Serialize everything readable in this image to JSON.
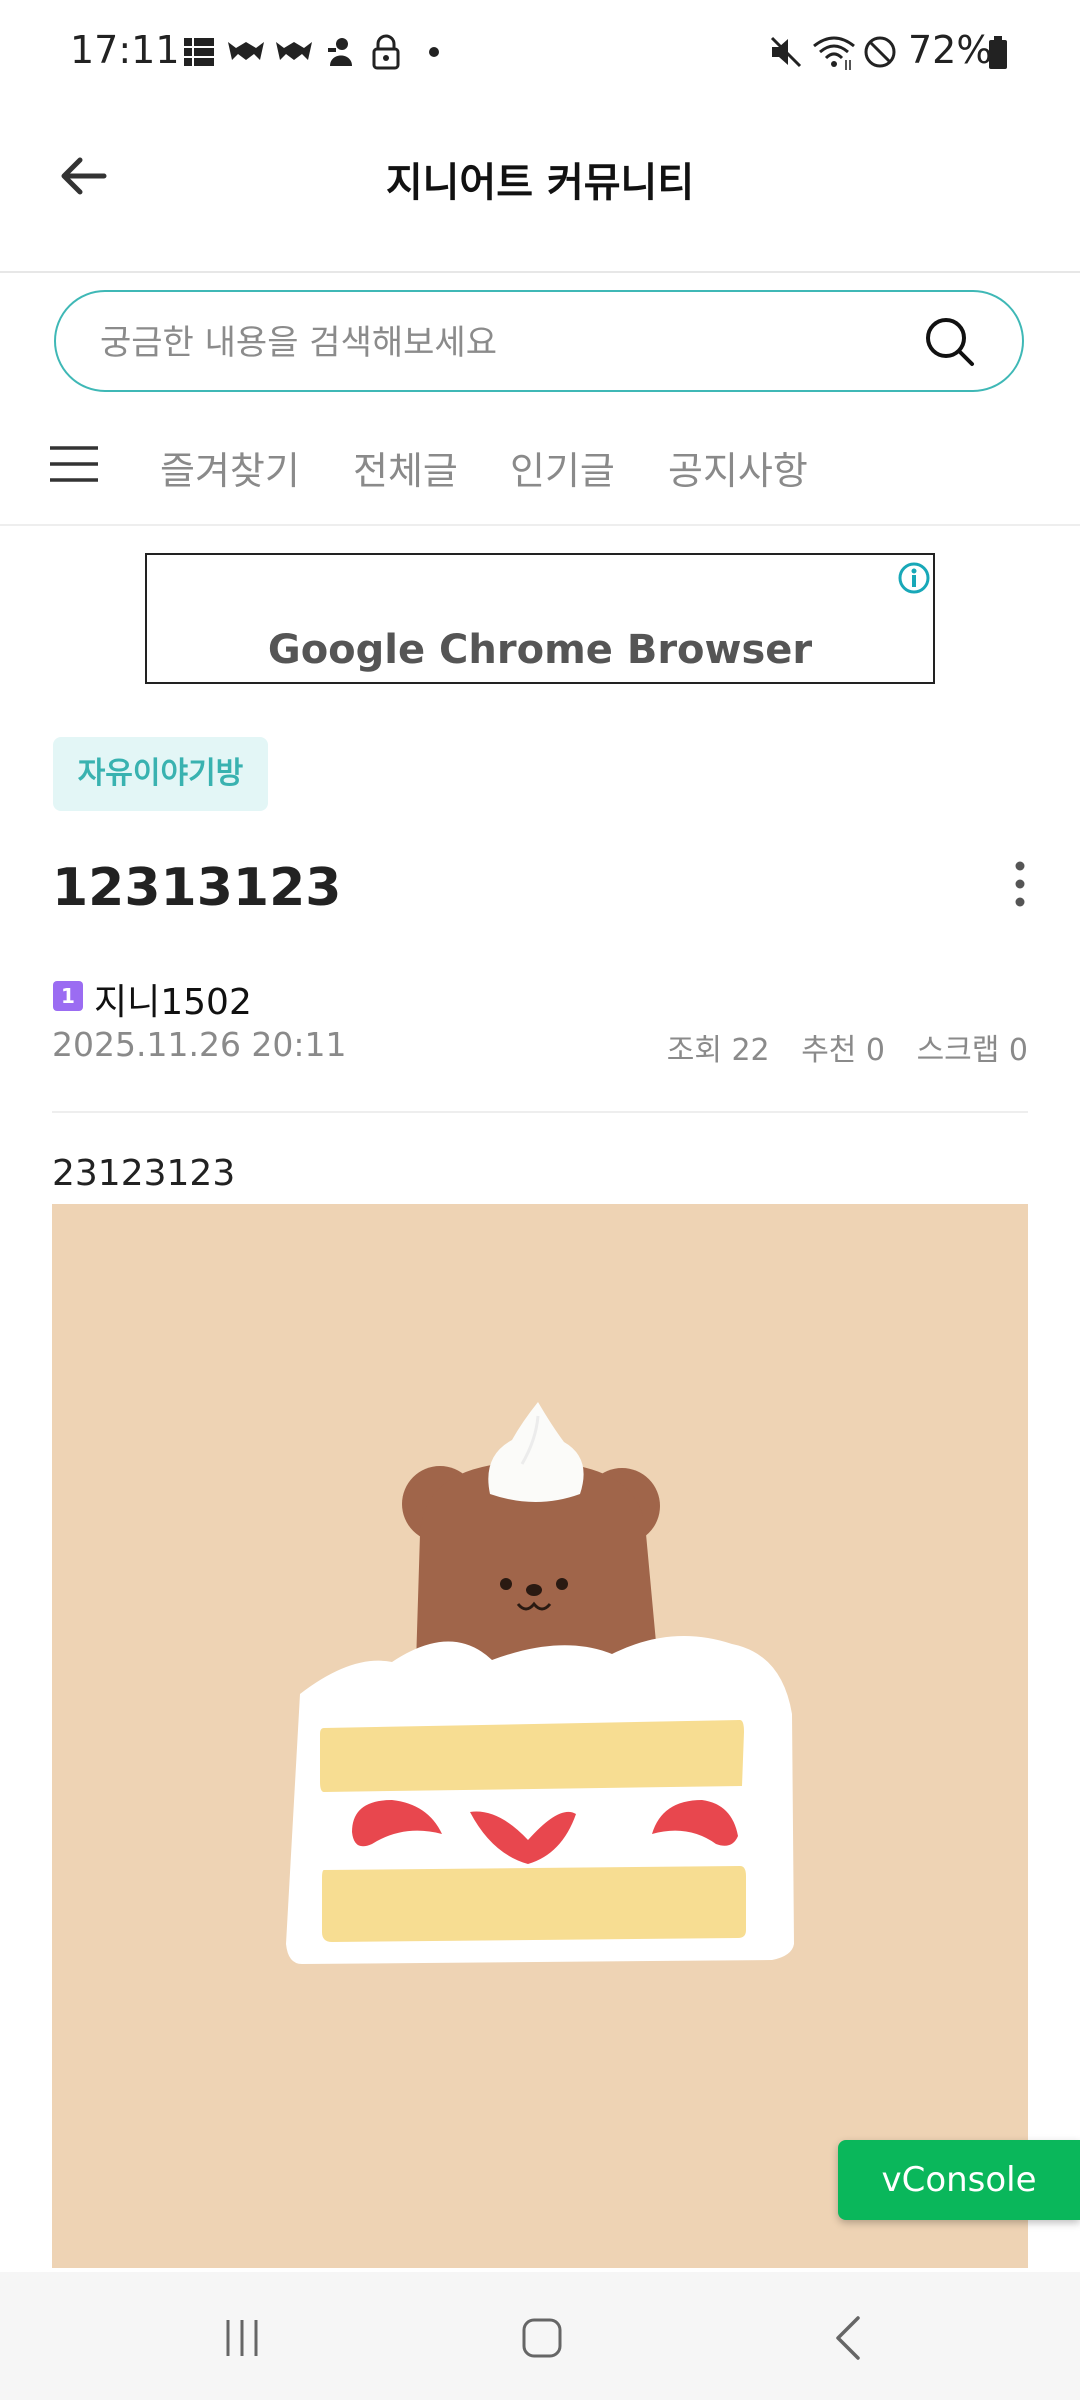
{
  "status_bar": {
    "time": "17:11",
    "battery": "72%"
  },
  "header": {
    "title": "지니어트 커뮤니티"
  },
  "search": {
    "placeholder": "궁금한 내용을 검색해보세요"
  },
  "tabs": [
    {
      "label": "즐겨찾기"
    },
    {
      "label": "전체글"
    },
    {
      "label": "인기글"
    },
    {
      "label": "공지사항"
    }
  ],
  "ad": {
    "text": "Google Chrome Browser"
  },
  "post": {
    "category": "자유이야기방",
    "title": "12313123",
    "author_level": "1",
    "author": "지니1502",
    "date": "2025.11.26 20:11",
    "stats": {
      "views": "조회 22",
      "likes": "추천 0",
      "scraps": "스크랩 0"
    },
    "body": "23123123"
  },
  "vconsole": {
    "label": "vConsole"
  },
  "colors": {
    "accent": "#3fb8b6",
    "badge_bg": "#e3f6f6",
    "level_badge": "#9b6cf2",
    "vconsole": "#0ab75b",
    "image_bg": "#eed3b4"
  }
}
